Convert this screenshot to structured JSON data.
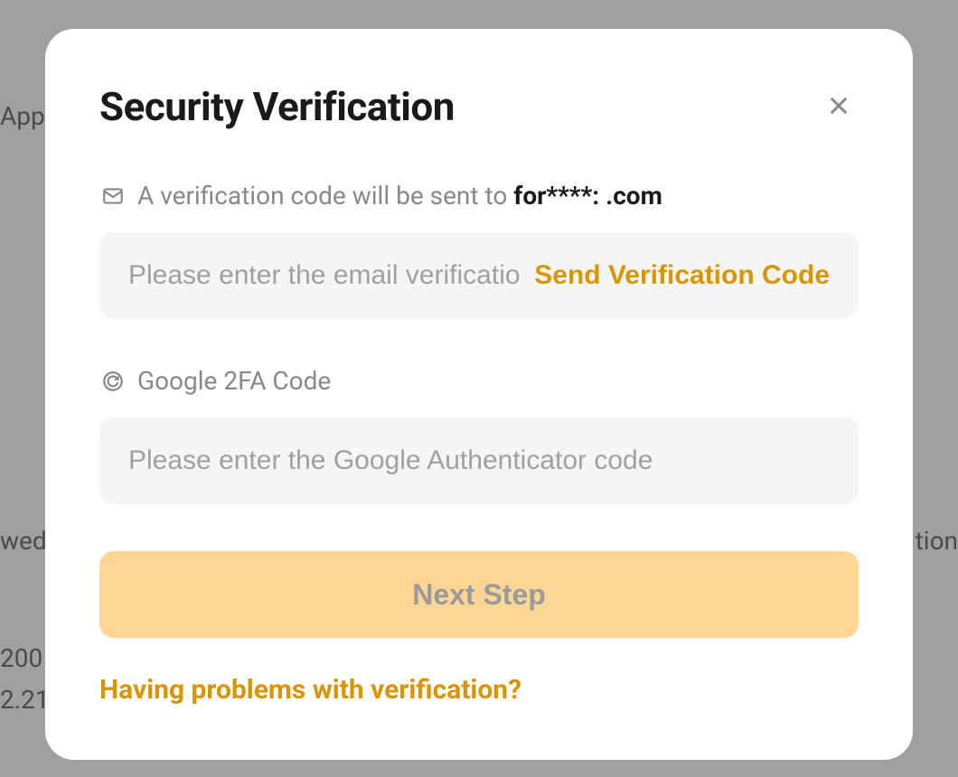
{
  "backdrop": {
    "text1": "App",
    "text2": "wed",
    "text3": "200",
    "text4": "2.21",
    "text5": "tion"
  },
  "modal": {
    "title": "Security Verification",
    "email_section": {
      "label_prefix": "A verification code will be sent to ",
      "email": "for****:                        .com",
      "placeholder": "Please enter the email verification code",
      "send_button": "Send Verification Code"
    },
    "google_section": {
      "label": "Google 2FA Code",
      "placeholder": "Please enter the Google Authenticator code"
    },
    "next_button": "Next Step",
    "help_link": "Having problems with verification?"
  }
}
